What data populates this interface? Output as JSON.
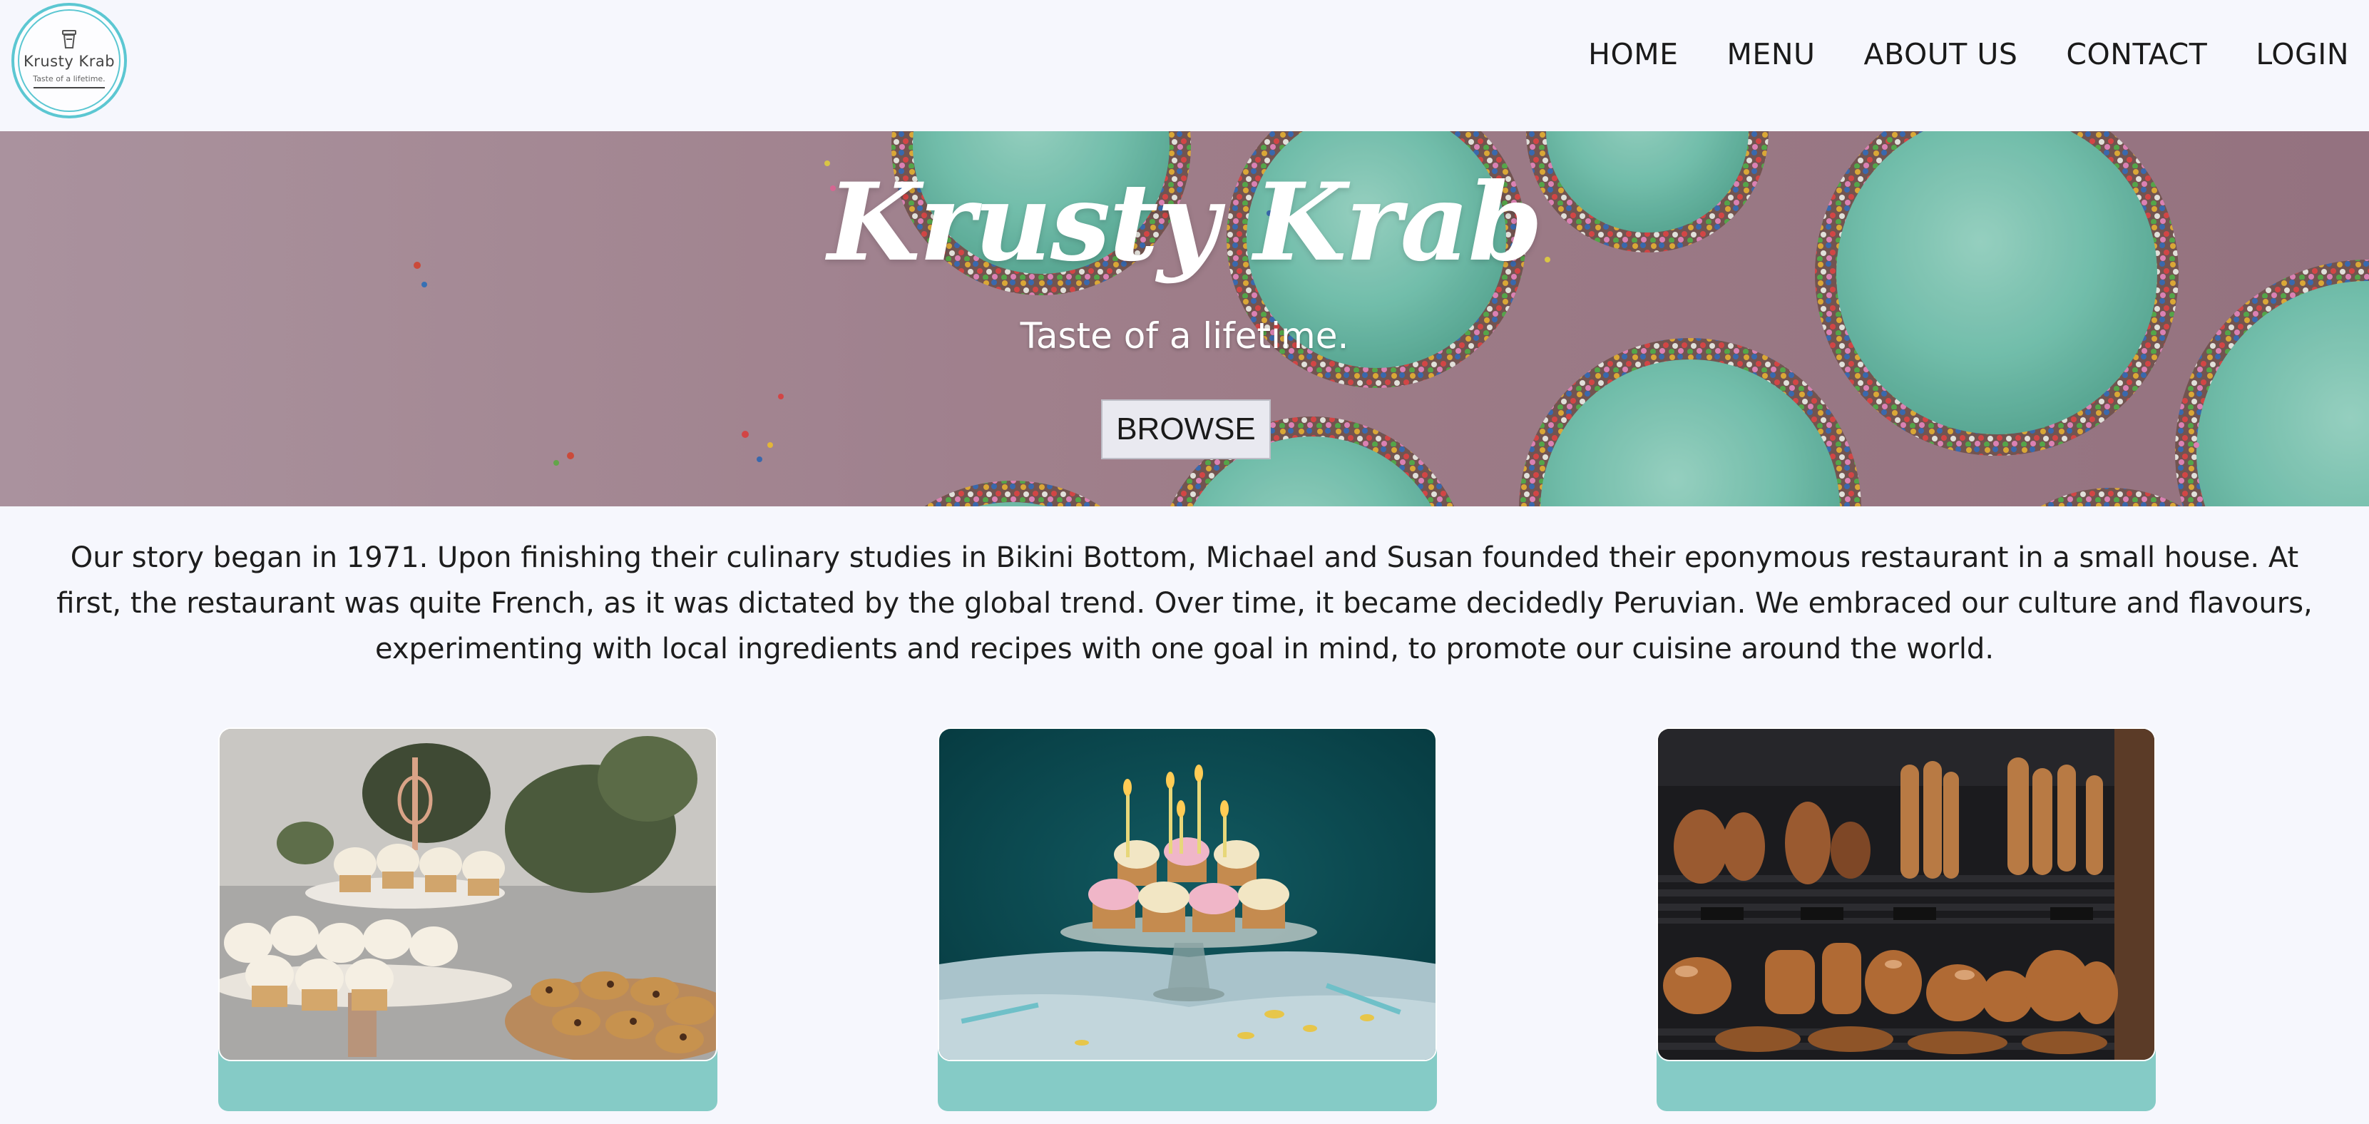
{
  "logo": {
    "title": "Krusty Krab",
    "tagline": "Taste of a lifetime."
  },
  "nav": {
    "items": [
      {
        "label": "HOME"
      },
      {
        "label": "MENU"
      },
      {
        "label": "ABOUT US"
      },
      {
        "label": "CONTACT"
      },
      {
        "label": "LOGIN"
      }
    ]
  },
  "hero": {
    "title": "Krusty Krab",
    "subtitle": "Taste of a lifetime.",
    "button_label": "BROWSE"
  },
  "story": {
    "text": "Our story began in 1971. Upon finishing their culinary studies in Bikini Bottom, Michael and Susan founded their eponymous restaurant in a small house. At first, the restaurant was quite French, as it was dictated by the global trend. Over time, it became decidedly Peruvian. We embraced our culture and flavours, experimenting with local ingredients and recipes with one goal in mind, to promote our cuisine around the world."
  },
  "cards": [
    {
      "image": "cupcakes-and-cookies-photo"
    },
    {
      "image": "birthday-cupcakes-photo"
    },
    {
      "image": "bakery-bread-shelf-photo"
    }
  ],
  "colors": {
    "background": "#f6f7fd",
    "accent_teal": "#85cbc6",
    "logo_ring": "#5cc7d2",
    "hero_pink": "#a98994",
    "frosting_mint": "#79c9b5"
  }
}
